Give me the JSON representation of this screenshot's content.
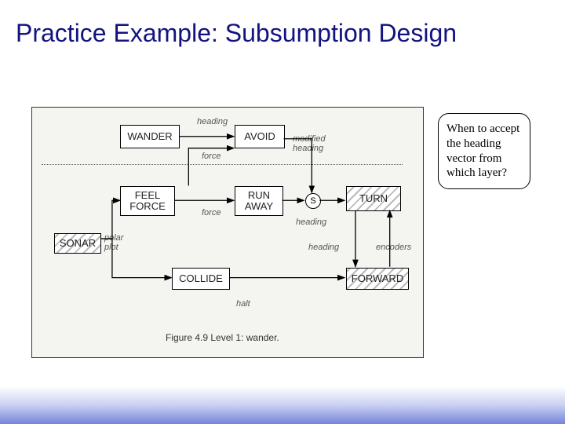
{
  "title": "Practice Example: Subsumption Design",
  "callout": "When to accept the heading vector from which layer?",
  "nodes": {
    "wander": "WANDER",
    "avoid": "AVOID",
    "feel_force": "FEEL\nFORCE",
    "run_away": "RUN\nAWAY",
    "s": "S",
    "turn": "TURN",
    "sonar": "SONAR",
    "collide": "COLLIDE",
    "forward": "FORWARD"
  },
  "edges": {
    "heading1": "heading",
    "modified_heading": "modified\nheading",
    "force1": "force",
    "force2": "force",
    "heading2": "heading",
    "heading3": "heading",
    "encoders": "encoders",
    "polar_plot": "polar\nplot",
    "halt": "halt"
  },
  "caption": "Figure 4.9   Level 1: wander."
}
